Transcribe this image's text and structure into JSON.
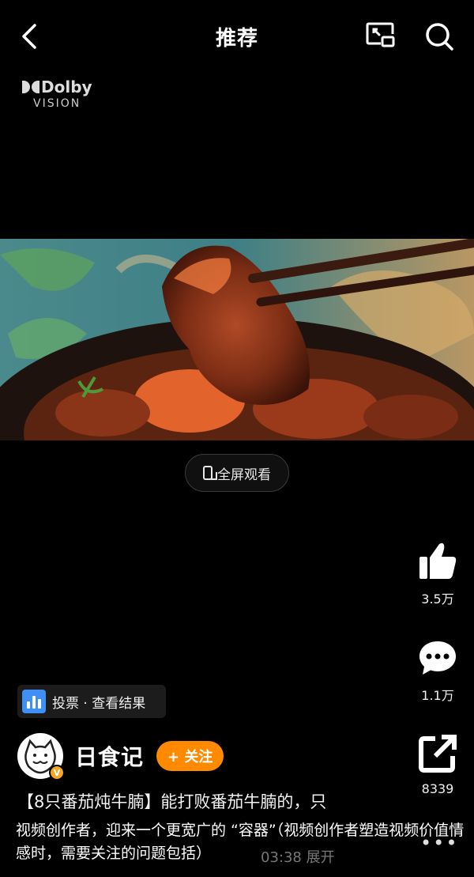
{
  "header": {
    "title": "推荐",
    "back_icon": "chevron-left-icon",
    "pip_icon": "picture-in-picture-icon",
    "search_icon": "search-icon"
  },
  "watermark": {
    "brand": "Dolby",
    "sub": "VISION"
  },
  "player": {
    "fullscreen_label": "全屏观看"
  },
  "actions": {
    "likes": "3.5万",
    "comments": "1.1万",
    "shares": "8339"
  },
  "vote": {
    "label": "投票 · 查看结果"
  },
  "author": {
    "name": "日食记",
    "follow_label": "+ 关注",
    "badge": "V"
  },
  "description": "【8只番茄炖牛腩】能打败番茄牛腩的，只",
  "caption": "视频创作者，迎来一个更宽广的 “容器”（视频创作者塑造视频价值情感时，需要关注的问题包括）",
  "meta": {
    "duration": "03:38",
    "expand_label": "展开",
    "more_label": "•••"
  },
  "colors": {
    "accent": "#ff8a00",
    "vote_icon": "#3f8ff5",
    "background": "#000000"
  }
}
